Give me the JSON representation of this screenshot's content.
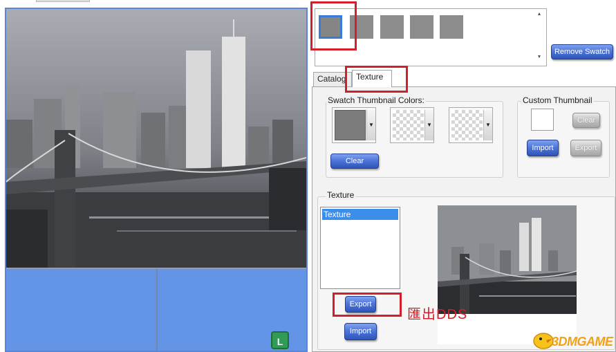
{
  "swatch_panel": {
    "swatches": [
      "swatch-1",
      "swatch-2",
      "swatch-3",
      "swatch-4",
      "swatch-5"
    ],
    "selected_index": 0,
    "remove_swatch_label": "Remove Swatch"
  },
  "tabs": [
    {
      "label": "Catalog",
      "active": false
    },
    {
      "label": "Texture",
      "active": true
    }
  ],
  "swatch_thumbnail_colors": {
    "title": "Swatch Thumbnail Colors:",
    "clear_label": "Clear"
  },
  "custom_thumbnail": {
    "title": "Custom Thumbnail",
    "clear_label": "Clear",
    "import_label": "Import",
    "export_label": "Export"
  },
  "texture_section": {
    "title": "Texture",
    "items": [
      "Texture"
    ],
    "selected_index": 0,
    "export_label": "Export",
    "import_label": "Import"
  },
  "annotation": "匯出DDS",
  "viewport": {
    "corner_badge": "L"
  },
  "watermark": "3DMGAME",
  "colors": {
    "accent_blue": "#4d74d8",
    "highlight_red": "#d21f2a",
    "viewport_blue": "#6394e6",
    "swatch_gray": "#8c8c8c"
  }
}
